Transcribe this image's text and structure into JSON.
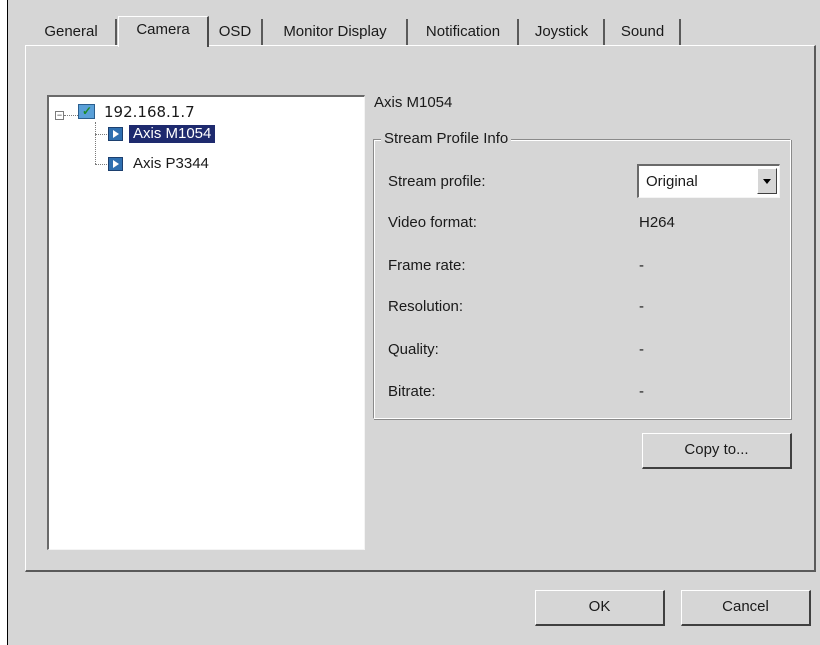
{
  "tabs": [
    {
      "label": "General",
      "active": false
    },
    {
      "label": "Camera",
      "active": true
    },
    {
      "label": "OSD",
      "active": false
    },
    {
      "label": "Monitor Display",
      "active": false
    },
    {
      "label": "Notification",
      "active": false
    },
    {
      "label": "Joystick",
      "active": false
    },
    {
      "label": "Sound",
      "active": false
    }
  ],
  "tree": {
    "expander": "⊟",
    "root": {
      "label": "192.168.1.7",
      "icon": "network-device-icon"
    },
    "children": [
      {
        "label": "Axis M1054",
        "icon": "camera-icon",
        "selected": true
      },
      {
        "label": "Axis P3344",
        "icon": "camera-icon",
        "selected": false
      }
    ]
  },
  "camera_title": "Axis M1054",
  "stream_info": {
    "group_title": "Stream Profile Info",
    "stream_profile": {
      "label": "Stream profile:",
      "value": "Original"
    },
    "rows": [
      {
        "label": "Video format:",
        "value": "H264"
      },
      {
        "label": "Frame rate:",
        "value": "-"
      },
      {
        "label": "Resolution:",
        "value": "-"
      },
      {
        "label": "Quality:",
        "value": "-"
      },
      {
        "label": "Bitrate:",
        "value": "-"
      }
    ]
  },
  "buttons": {
    "copy_to": "Copy to...",
    "ok": "OK",
    "cancel": "Cancel"
  },
  "colors": {
    "dialog_bg": "#d6d6d6",
    "selection_bg": "#1e2a6e",
    "camera_icon": "#2f6fb0"
  }
}
